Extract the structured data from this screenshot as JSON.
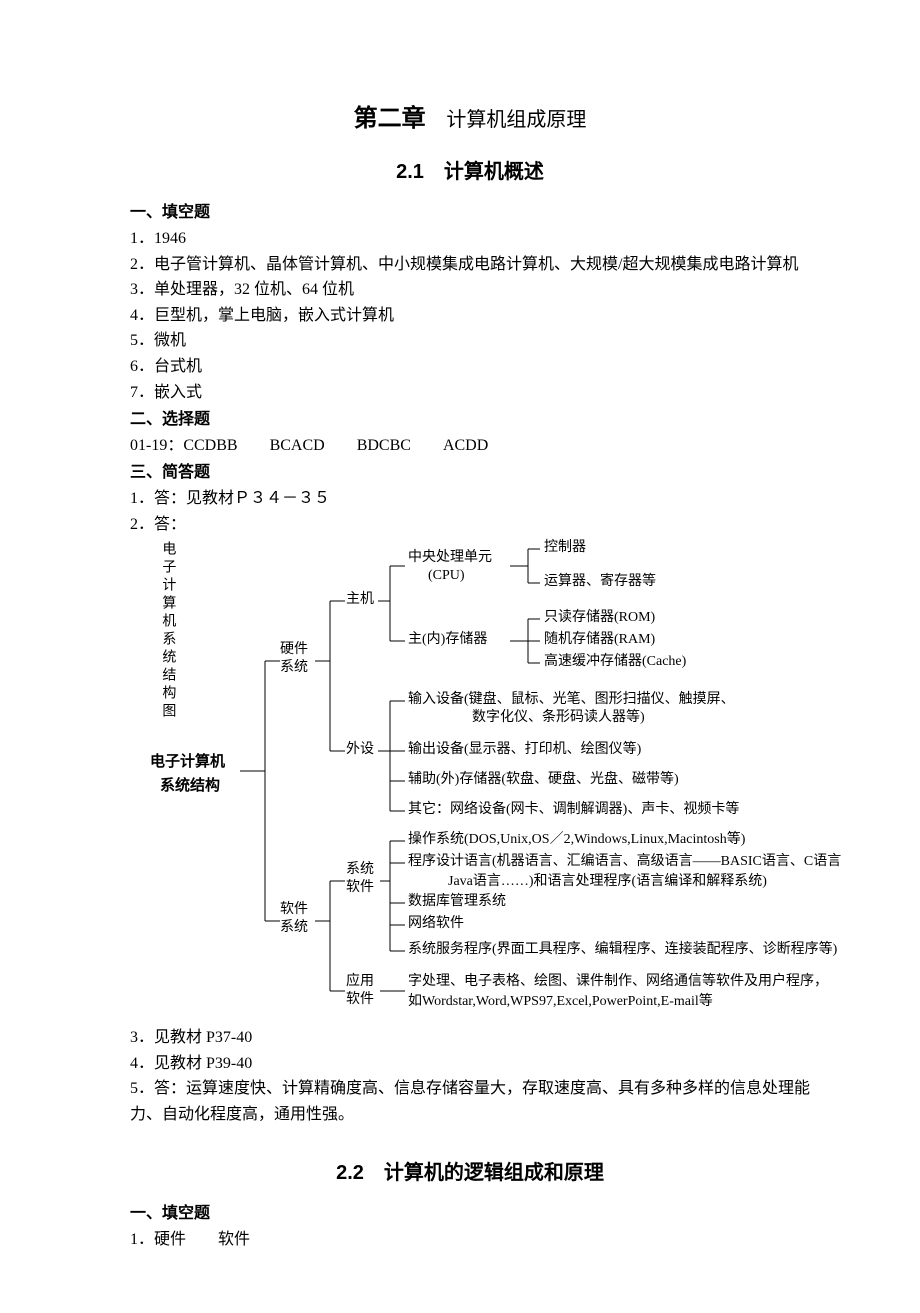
{
  "chapter": {
    "num": "第二章",
    "title": "计算机组成原理"
  },
  "section21": {
    "title": "2.1　计算机概述",
    "fill_head": "一、填空题",
    "fill": {
      "a1": "1．1946",
      "a2": "2．电子管计算机、晶体管计算机、中小规模集成电路计算机、大规模/超大规模集成电路计算机",
      "a3": "3．单处理器，32 位机、64 位机",
      "a4": "4．巨型机，掌上电脑，嵌入式计算机",
      "a5": "5．微机",
      "a6": "6．台式机",
      "a7": "7．嵌入式"
    },
    "choice_head": "二、选择题",
    "choice": "01-19：CCDBB　　BCACD　　BDCBC　　ACDD",
    "short_head": "三、简答题",
    "short": {
      "s1": "1．答：见教材Ｐ３４－３５",
      "s2": "2．答：",
      "s3": "3．见教材 P37-40",
      "s4": "4．见教材 P39-40",
      "s5": "5．答：运算速度快、计算精确度高、信息存储容量大，存取速度高、具有多种多样的信息处理能力、自动化程度高，通用性强。"
    }
  },
  "diagram": {
    "vtitle": "电子计算机系统结构图",
    "htitle1": "电子计算机",
    "htitle2": "系统结构",
    "hw_sys": "硬件\n系统",
    "sw_sys": "软件\n系统",
    "host": "主机",
    "periph": "外设",
    "cpu_l1": "中央处理单元",
    "cpu_l2": "(CPU)",
    "mainmem": "主(内)存储器",
    "ctrl": "控制器",
    "alu": "运算器、寄存器等",
    "rom": "只读存储器(ROM)",
    "ram": "随机存储器(RAM)",
    "cache": "高速缓冲存储器(Cache)",
    "input": "输入设备(键盘、鼠标、光笔、图形扫描仪、触摸屏、",
    "input2": "数字化仪、条形码读人器等)",
    "output": "输出设备(显示器、打印机、绘图仪等)",
    "aux": "辅助(外)存储器(软盘、硬盘、光盘、磁带等)",
    "other": "其它：网络设备(网卡、调制解调器)、声卡、视频卡等",
    "sys_sw": "系统\n软件",
    "app_sw": "应用\n软件",
    "os": "操作系统(DOS,Unix,OS／2,Windows,Linux,Macintosh等)",
    "lang1": "程序设计语言(机器语言、汇编语言、高级语言——BASIC语言、C语言",
    "lang2": "Java语言……)和语言处理程序(语言编译和解释系统)",
    "db": "数据库管理系统",
    "net": "网络软件",
    "svc": "系统服务程序(界面工具程序、编辑程序、连接装配程序、诊断程序等)",
    "app1": "字处理、电子表格、绘图、课件制作、网络通信等软件及用户程序，",
    "app2": "如Wordstar,Word,WPS97,Excel,PowerPoint,E-mail等"
  },
  "section22": {
    "title": "2.2　计算机的逻辑组成和原理",
    "fill_head": "一、填空题",
    "a1": "1．硬件　　软件"
  }
}
